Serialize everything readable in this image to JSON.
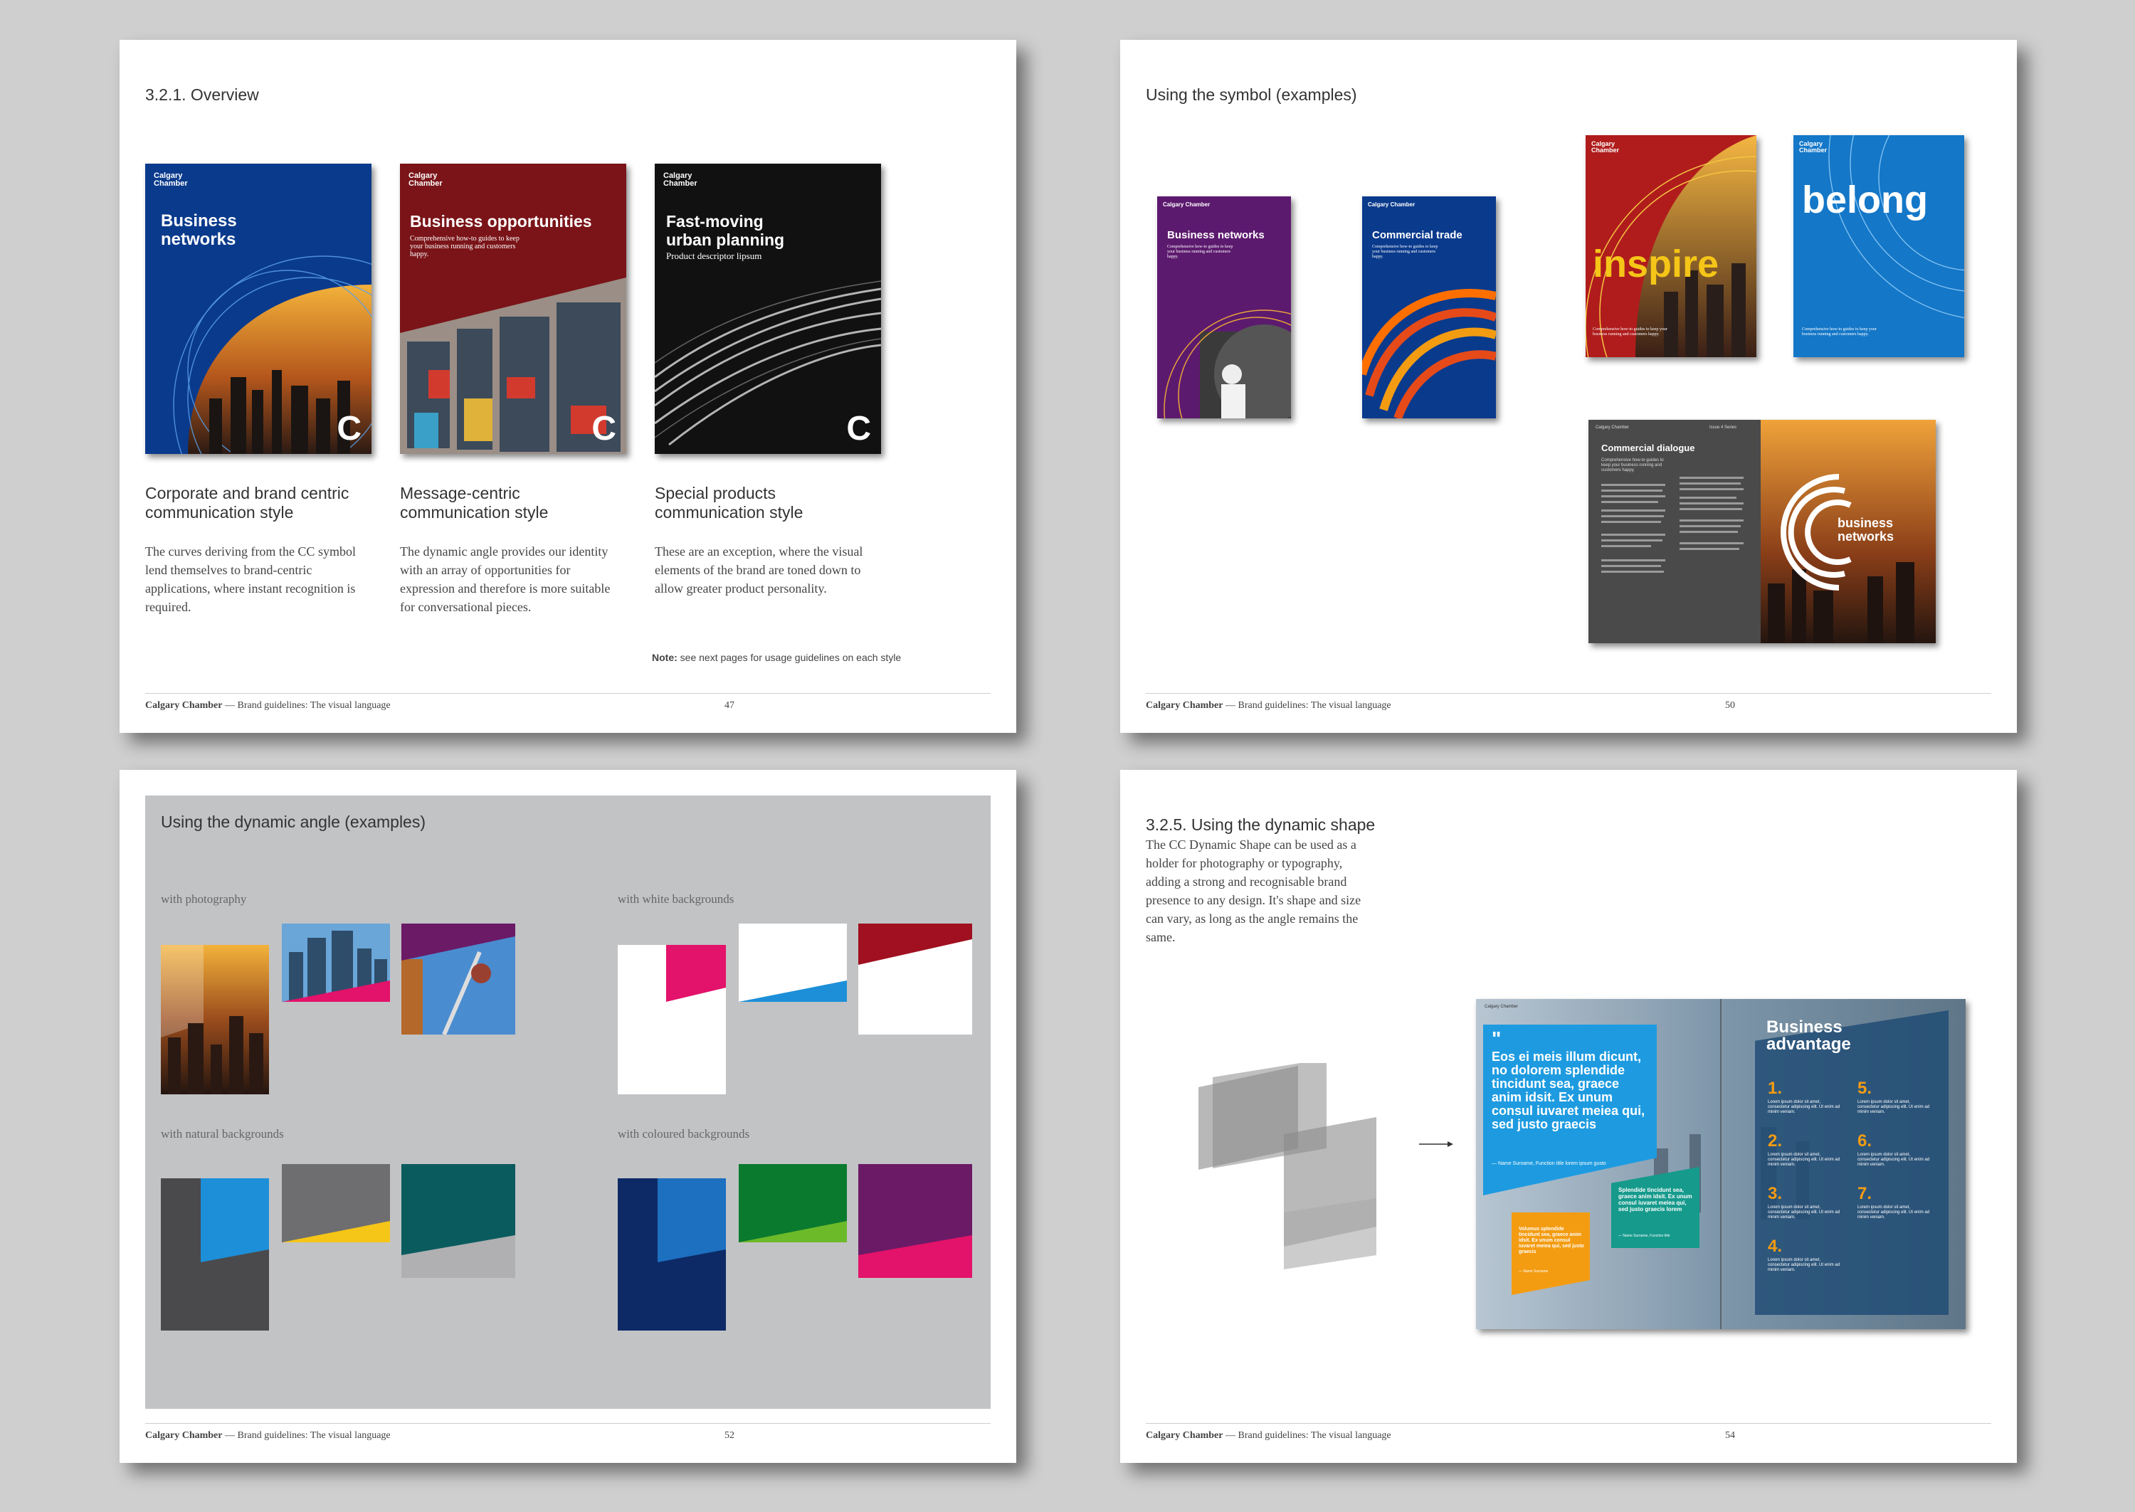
{
  "footer": {
    "brand": "Calgary Chamber",
    "rest": " — Brand guidelines: The visual language"
  },
  "p1": {
    "heading": "3.2.1.  Overview",
    "page": "47",
    "covers": [
      {
        "brand": "Calgary Chamber",
        "title": "Business networks",
        "color": "#0a3a8c",
        "logo": "C"
      },
      {
        "brand": "Calgary Chamber",
        "title": "Business opportunities",
        "sub": "Comprehensive how-to guides to keep your business running and customers happy.",
        "color": "#7a1418",
        "logo": "C"
      },
      {
        "brand": "Calgary Chamber",
        "title": "Fast-moving urban planning",
        "sub": "Product descriptor lipsum",
        "color": "#111111",
        "logo": "C"
      }
    ],
    "sections": [
      {
        "title": "Corporate and brand centric communication style",
        "body": "The curves deriving from the CC symbol lend themselves to brand-centric applications, where instant recognition is required."
      },
      {
        "title": "Message-centric communication style",
        "body": "The dynamic angle provides our identity with an array of opportunities for expression and therefore is more suitable for conversational pieces."
      },
      {
        "title": "Special products communication style",
        "body": "These are an exception, where the visual elements of the brand are toned down to allow greater product personality."
      }
    ],
    "note_bold": "Note:",
    "note": " see next pages for usage guidelines on each style"
  },
  "p2": {
    "heading": "Using the symbol (examples)",
    "page": "50",
    "covers": [
      {
        "brand": "Calgary Chamber",
        "title": "Business networks",
        "sub": "Comprehensive how-to guides to keep your business running and customers happy.",
        "color": "#5c1a6e"
      },
      {
        "brand": "Calgary Chamber",
        "title": "Commercial trade",
        "sub": "Comprehensive how-to guides to keep your business running and customers happy.",
        "color": "#0a3a8c"
      },
      {
        "brand": "Calgary Chamber",
        "title": "inspire",
        "sub": "Comprehensive how-to guides to keep your business running and customers happy.",
        "color": "#b01c1c"
      },
      {
        "brand": "Calgary Chamber",
        "title": "belong",
        "sub": "Comprehensive how-to guides to keep your business running and customers happy.",
        "color": "#1477c8"
      }
    ],
    "spread": {
      "brand": "Calgary Chamber",
      "header_right": "Issue 4 Series",
      "title": "Commercial dialogue",
      "sub": "Comprehensive how-to guides to keep your business running and customers happy.",
      "logo_text": "business networks"
    }
  },
  "p3": {
    "heading": "Using the dynamic angle (examples)",
    "page": "52",
    "labels": {
      "photo": "with photography",
      "white": "with white backgrounds",
      "natural": "with natural backgrounds",
      "coloured": "with coloured backgrounds"
    }
  },
  "p4": {
    "heading": "3.2.5.  Using the dynamic shape",
    "body": "The CC Dynamic Shape can be used as a holder for photography or typography, adding a strong and recognisable brand presence to any design. It's shape and size can vary, as long as the angle remains the same.",
    "page": "54",
    "spread": {
      "brand": "Calgary Chamber",
      "quote": "Eos ei meis illum dicunt, no dolorem splendide tincidunt sea, graece anim idsit. Ex unum consul iuvaret meiea qui, sed justo graecis",
      "quote_credit": "— Name Surname, Function title lorem ipsum gusto",
      "quote2": "Splendide tincidunt sea, graece anim idsit. Ex unum consul iuvaret meiea qui, sed justo graecis lorem",
      "quote2_credit": "— Name Surname, Function title",
      "quote3": "Volumus splendide tincidunt sea, graece anim idsit. Ex unum consul iuvaret meiea qui, sed justo graecis",
      "quote3_credit": "— Name Surname",
      "right_title": "Business advantage",
      "nums": [
        "1.",
        "2.",
        "3.",
        "4.",
        "5.",
        "6.",
        "7."
      ],
      "item_text": "Lorem ipsum dolor sit amet, consectetur adipiscing elit. Ut enim ad minim veniam."
    }
  }
}
